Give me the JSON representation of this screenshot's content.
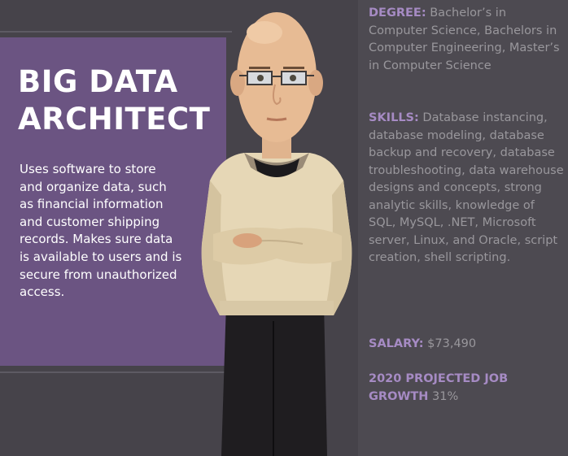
{
  "title": {
    "line1": "BIG DATA",
    "line2": "ARCHITECT"
  },
  "description": "Uses software to store and organize data, such as financial information and customer shipping records. Makes sure data is available to users and is secure from unauthorized access.",
  "degree": {
    "label": "DEGREE:",
    "value": "Bachelor’s in Computer Science, Bachelors in Computer Engineering, Master’s in Computer Science"
  },
  "skills": {
    "label": "SKILLS:",
    "value": "Database instancing, database modeling, database backup and recovery, database troubleshooting, data warehouse designs and concepts, strong analytic skills, knowledge of SQL, MySQL, .NET, Microsoft server, Linux, and Oracle, script creation, shell scripting."
  },
  "salary": {
    "label": "SALARY:",
    "value": "$73,490"
  },
  "growth": {
    "label": "2020 PROJECTED JOB GROWTH",
    "value": "31%"
  },
  "colors": {
    "background": "#46434a",
    "panel_purple": "#6b5482",
    "label_purple": "#a68bc4",
    "body_gray": "#99979c",
    "sweater": "#e6d7b6",
    "pants": "#1f1d20"
  }
}
